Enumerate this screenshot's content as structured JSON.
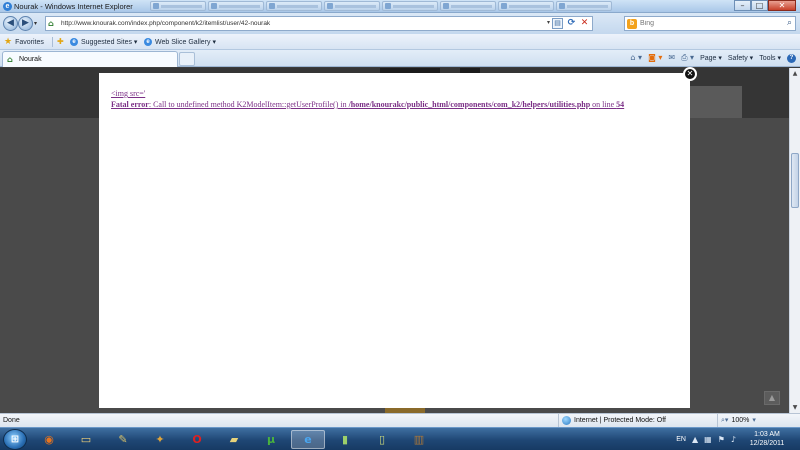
{
  "window": {
    "title": "Nourak - Windows Internet Explorer",
    "minimize": "–",
    "maximize": "□",
    "close": "✕"
  },
  "address_bar": {
    "url": "http://www.knourak.com/index.php/component/k2/itemlist/user/42-nourak",
    "search_placeholder": "Bing"
  },
  "favorites_bar": {
    "favorites_label": "Favorites",
    "suggested_sites": "Suggested Sites ▾",
    "web_slice_gallery": "Web Slice Gallery ▾"
  },
  "tab": {
    "label": "Nourak"
  },
  "command_bar": {
    "page": "Page ▾",
    "safety": "Safety ▾",
    "tools": "Tools ▾"
  },
  "modal": {
    "line1": "<img src='",
    "error_label": "Fatal error",
    "error_text": ": Call to undefined method K2ModelItem::getUserProfile() in ",
    "error_path": "/home/knourakc/public_html/components/com_k2/helpers/utilities.php",
    "on_line": " on line ",
    "line_number": "54"
  },
  "status_bar": {
    "status": "Done",
    "zone": "Internet | Protected Mode: Off",
    "zoom": "100%"
  },
  "taskbar": {
    "apps": [
      {
        "name": "firefox",
        "color": "#e8741e",
        "glyph": "◉",
        "active": false
      },
      {
        "name": "explorer",
        "color": "#f2d27a",
        "glyph": "▭",
        "active": false
      },
      {
        "name": "tools",
        "color": "#d9c36a",
        "glyph": "✎",
        "active": false
      },
      {
        "name": "game",
        "color": "#e0a43a",
        "glyph": "✦",
        "active": false
      },
      {
        "name": "opera",
        "color": "#e02020",
        "glyph": "O",
        "active": false
      },
      {
        "name": "messenger",
        "color": "#e8d37a",
        "glyph": "▰",
        "active": false
      },
      {
        "name": "utorrent",
        "color": "#49b23e",
        "glyph": "µ",
        "active": false
      },
      {
        "name": "internet-explorer",
        "color": "#4aa6f0",
        "glyph": "e",
        "active": true
      },
      {
        "name": "paint",
        "color": "#9ccf6a",
        "glyph": "▮",
        "active": false
      },
      {
        "name": "notepad",
        "color": "#c9d67a",
        "glyph": "▯",
        "active": false
      },
      {
        "name": "winrar",
        "color": "#a8763a",
        "glyph": "▥",
        "active": false
      }
    ],
    "language": "EN",
    "time": "1:03 AM",
    "date": "12/28/2011"
  }
}
